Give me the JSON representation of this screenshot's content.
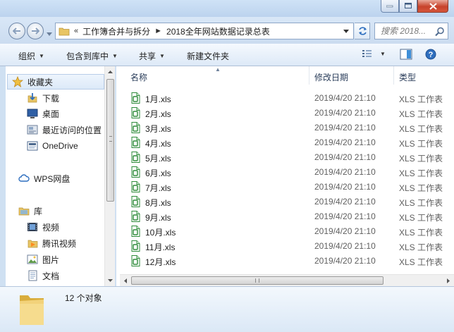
{
  "address": {
    "crumbs": [
      "«",
      "工作簿合并与拆分",
      "2018全年网站数据记录总表"
    ],
    "search_placeholder": "搜索 2018..."
  },
  "toolbar": {
    "organize": "组织",
    "include_in_library": "包含到库中",
    "share": "共享",
    "new_folder": "新建文件夹"
  },
  "nav": {
    "favorites": "收藏夹",
    "downloads": "下载",
    "desktop": "桌面",
    "recent": "最近访问的位置",
    "onedrive": "OneDrive",
    "wps": "WPS网盘",
    "libraries": "库",
    "videos": "视频",
    "tencent_video": "腾讯视频",
    "pictures": "图片",
    "documents": "文档"
  },
  "columns": {
    "name": "名称",
    "modified": "修改日期",
    "type": "类型"
  },
  "files": [
    {
      "name": "1月.xls",
      "modified": "2019/4/20 21:10",
      "type": "XLS 工作表"
    },
    {
      "name": "2月.xls",
      "modified": "2019/4/20 21:10",
      "type": "XLS 工作表"
    },
    {
      "name": "3月.xls",
      "modified": "2019/4/20 21:10",
      "type": "XLS 工作表"
    },
    {
      "name": "4月.xls",
      "modified": "2019/4/20 21:10",
      "type": "XLS 工作表"
    },
    {
      "name": "5月.xls",
      "modified": "2019/4/20 21:10",
      "type": "XLS 工作表"
    },
    {
      "name": "6月.xls",
      "modified": "2019/4/20 21:10",
      "type": "XLS 工作表"
    },
    {
      "name": "7月.xls",
      "modified": "2019/4/20 21:10",
      "type": "XLS 工作表"
    },
    {
      "name": "8月.xls",
      "modified": "2019/4/20 21:10",
      "type": "XLS 工作表"
    },
    {
      "name": "9月.xls",
      "modified": "2019/4/20 21:10",
      "type": "XLS 工作表"
    },
    {
      "name": "10月.xls",
      "modified": "2019/4/20 21:10",
      "type": "XLS 工作表"
    },
    {
      "name": "11月.xls",
      "modified": "2019/4/20 21:10",
      "type": "XLS 工作表"
    },
    {
      "name": "12月.xls",
      "modified": "2019/4/20 21:10",
      "type": "XLS 工作表"
    }
  ],
  "status": {
    "count": "12 个对象"
  },
  "colors": {
    "accent": "#3a6ea5",
    "xls_icon": "#2e8b3a",
    "folder": "#e8c564"
  }
}
